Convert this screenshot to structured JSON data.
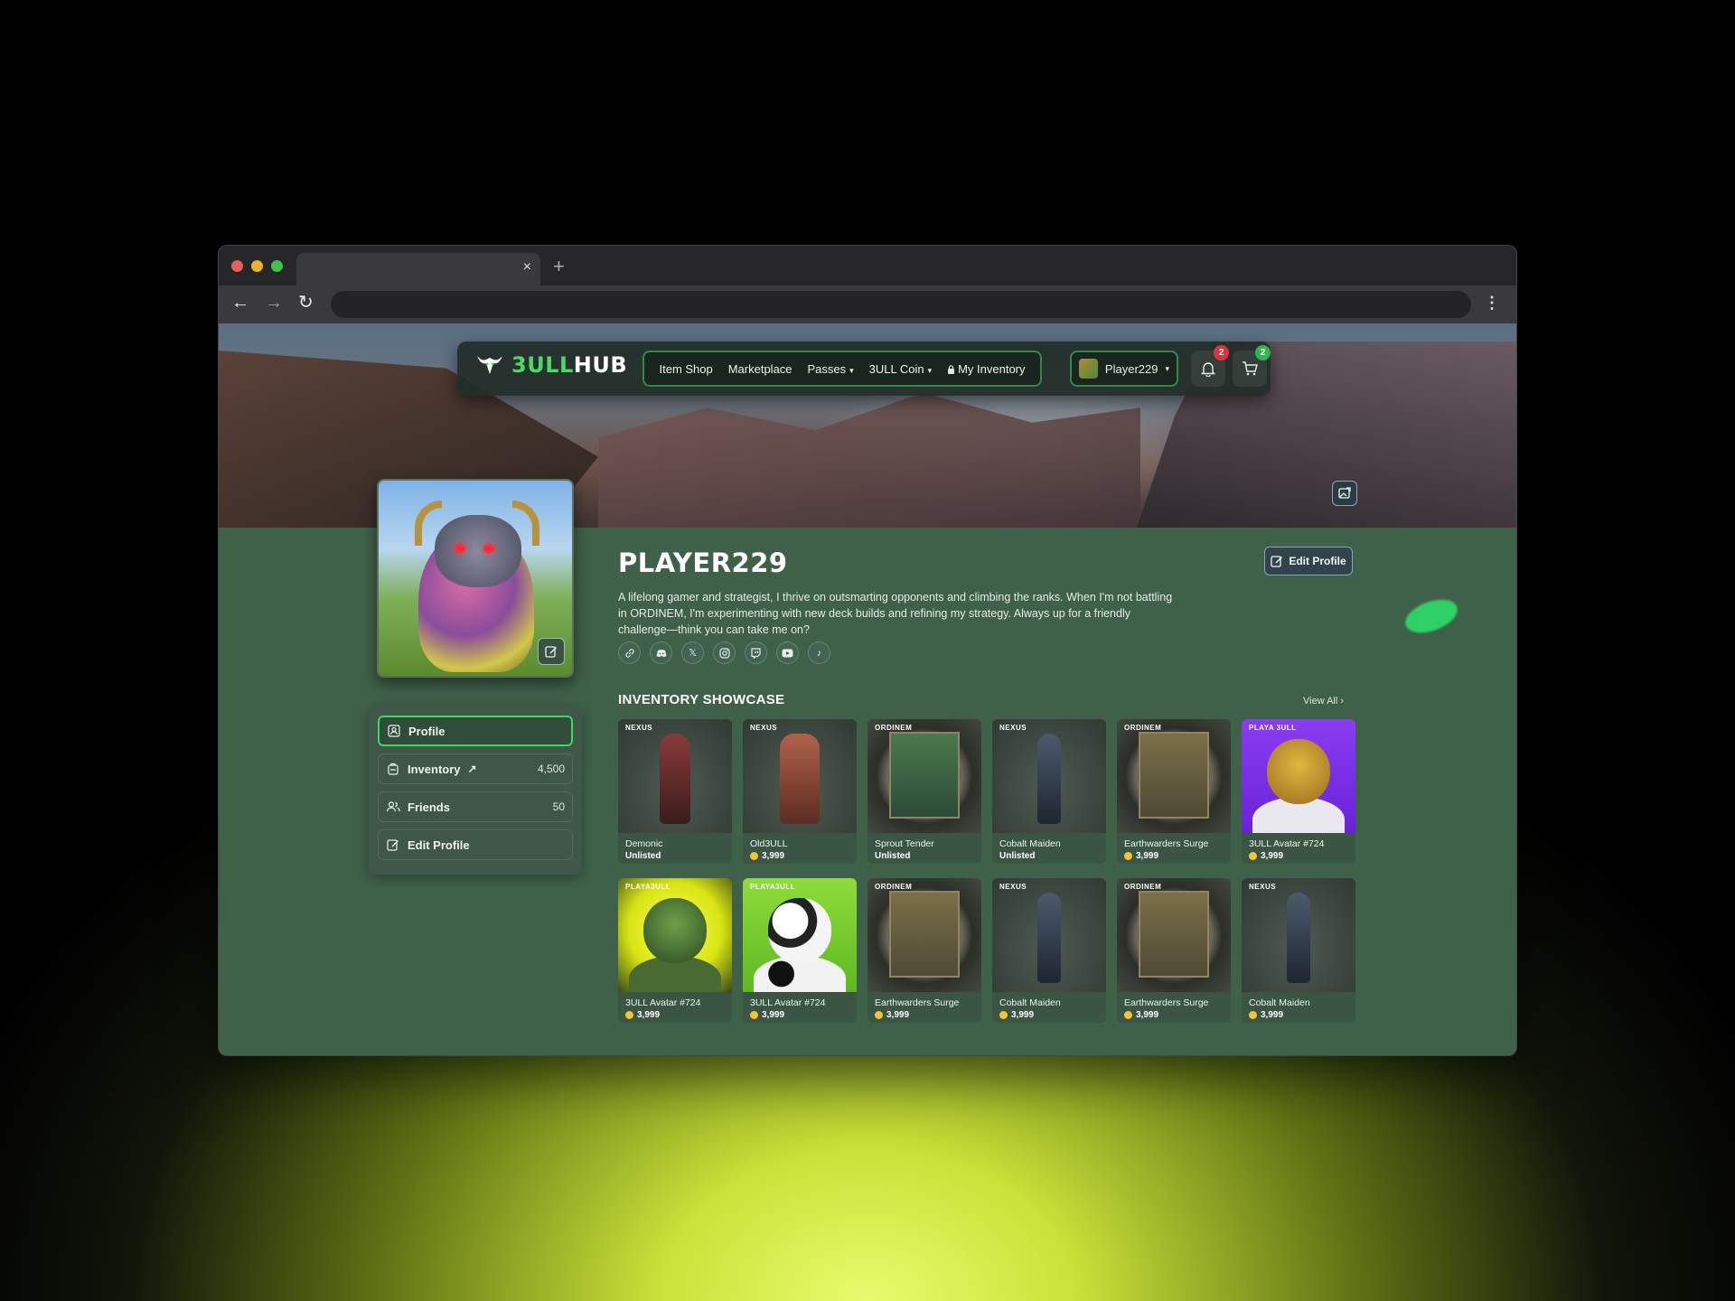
{
  "browser": {
    "tab_close": "×",
    "new_tab": "+",
    "back": "←",
    "forward": "→",
    "reload": "↻",
    "menu": "⋮"
  },
  "nav": {
    "logo_part1": "3ULL",
    "logo_part2": "HUB",
    "items": [
      {
        "label": "Item Shop",
        "dropdown": false
      },
      {
        "label": "Marketplace",
        "dropdown": false
      },
      {
        "label": "Passes",
        "dropdown": true
      },
      {
        "label": "3ULL Coin",
        "dropdown": true
      },
      {
        "label": "My Inventory",
        "dropdown": false,
        "icon": "lock-icon"
      }
    ],
    "player_name": "Player229",
    "notifications_count": "2",
    "cart_count": "2",
    "accent_color": "#3ed665"
  },
  "profile": {
    "name": "PLAYER229",
    "bio": "A lifelong gamer and strategist, I thrive on outsmarting opponents and climbing the ranks. When I'm not battling in ORDINEM, I'm experimenting with new deck builds and refining my strategy. Always up for a friendly challenge—think you can take me on?",
    "edit_button": "Edit Profile",
    "socials": [
      "link-icon",
      "discord-icon",
      "x-icon",
      "instagram-icon",
      "twitch-icon",
      "youtube-icon",
      "tiktok-icon"
    ]
  },
  "sidebar": {
    "items": [
      {
        "label": "Profile",
        "count": "",
        "active": true
      },
      {
        "label": "Inventory",
        "count": "4,500",
        "external": true
      },
      {
        "label": "Friends",
        "count": "50"
      },
      {
        "label": "Edit Profile",
        "count": ""
      }
    ]
  },
  "showcase": {
    "title": "INVENTORY SHOWCASE",
    "view_all": "View All",
    "items": [
      {
        "brand": "NEXUS",
        "name": "Demonic",
        "status": "Unlisted",
        "price": ""
      },
      {
        "brand": "NEXUS",
        "name": "Old3ULL",
        "status": "",
        "price": "3,999"
      },
      {
        "brand": "ORDINEM",
        "name": "Sprout Tender",
        "status": "Unlisted",
        "price": ""
      },
      {
        "brand": "NEXUS",
        "name": "Cobalt Maiden",
        "status": "Unlisted",
        "price": ""
      },
      {
        "brand": "ORDINEM",
        "name": "Earthwarders Surge",
        "status": "",
        "price": "3,999"
      },
      {
        "brand": "PLAYA 3ULL",
        "name": "3ULL Avatar #724",
        "status": "",
        "price": "3,999"
      },
      {
        "brand": "PLAYA3ULL",
        "name": "3ULL Avatar #724",
        "status": "",
        "price": "3,999"
      },
      {
        "brand": "PLAYA3ULL",
        "name": "3ULL Avatar #724",
        "status": "",
        "price": "3,999"
      },
      {
        "brand": "ORDINEM",
        "name": "Earthwarders Surge",
        "status": "",
        "price": "3,999"
      },
      {
        "brand": "NEXUS",
        "name": "Cobalt Maiden",
        "status": "",
        "price": "3,999"
      },
      {
        "brand": "ORDINEM",
        "name": "Earthwarders Surge",
        "status": "",
        "price": "3,999"
      },
      {
        "brand": "NEXUS",
        "name": "Cobalt Maiden",
        "status": "",
        "price": "3,999"
      }
    ]
  }
}
